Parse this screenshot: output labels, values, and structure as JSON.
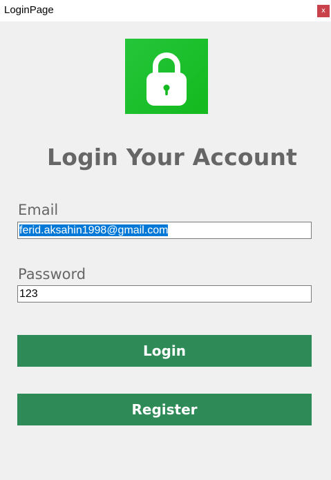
{
  "window": {
    "title": "LoginPage",
    "close_label": "x"
  },
  "logo": {
    "icon": "padlock-icon",
    "background_color": "#13b91e"
  },
  "heading": "Login Your Account",
  "form": {
    "email_label": "Email",
    "email_value": "ferid.aksahin1998@gmail.com",
    "password_label": "Password",
    "password_value": "123"
  },
  "buttons": {
    "login_label": "Login",
    "register_label": "Register",
    "color": "#2e8b57"
  }
}
